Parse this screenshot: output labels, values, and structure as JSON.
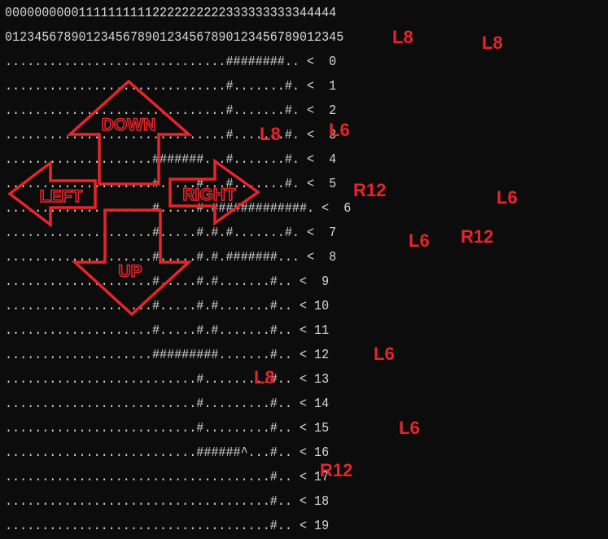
{
  "console": {
    "lines": [
      "000000000011111111112222222222333333333344444",
      "0123456789012345678901234567890123456789012345",
      "..............................########.. <  0",
      "..............................#.......#. <  1",
      "..............................#.......#. <  2",
      "..............................#.......#. <  3",
      "....................#######...#.......#. <  4",
      "....................#.....#...#.......#. <  5",
      "....................#.....#.#############. <  6",
      "....................#.....#.#.#.......#. <  7",
      "....................#.....#.#.#######... <  8",
      "....................#.....#.#.......#.. <  9",
      "....................#.....#.#.......#.. < 10",
      "....................#.....#.#.......#.. < 11",
      "....................#########.......#.. < 12",
      "..........................#.........#.. < 13",
      "..........................#.........#.. < 14",
      "..........................#.........#.. < 15",
      "..........................######^...#.. < 16",
      "....................................#.. < 17",
      "....................................#.. < 18",
      "....................................#.. < 19"
    ]
  },
  "arrows": {
    "down": "DOWN",
    "left": "LEFT",
    "right": "RIGHT",
    "up": "UP"
  },
  "annotations": {
    "a1": "L8",
    "a2": "L8",
    "a3": "L8",
    "a4": "L6",
    "a5": "R12",
    "a6": "L6",
    "a7": "L6",
    "a8": "R12",
    "a9": "L6",
    "a10": "L8",
    "a11": "L6",
    "a12": "R12"
  },
  "colors": {
    "background": "#0c0c0c",
    "text": "#d6d6d6",
    "annotation": "#e8242a"
  }
}
